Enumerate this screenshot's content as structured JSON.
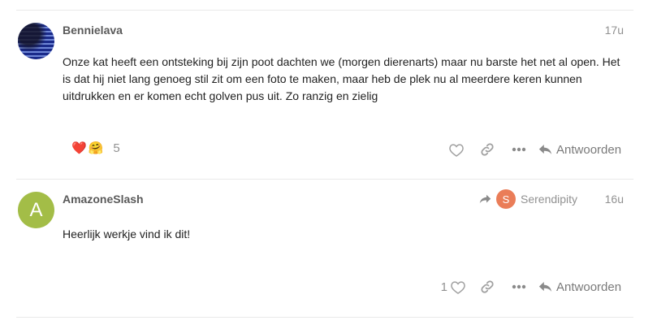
{
  "posts": [
    {
      "username": "Bennielava",
      "date": "17u",
      "avatar": "avatar-image-icon",
      "body": "Onze kat heeft een ontsteking bij zijn poot dachten we (morgen dierenarts) maar nu barste het net al open. Het is dat hij niet lang genoeg stil zit om een foto te maken, maar heb de plek nu al meerdere keren kunnen uitdrukken en er komen echt golven pus uit. Zo ranzig en zielig",
      "reactions": {
        "emojis": [
          "❤️",
          "🤗"
        ],
        "count": "5"
      },
      "actions": {
        "reply_label": "Antwoorden"
      }
    },
    {
      "username": "AmazoneSlash",
      "avatar_letter": "A",
      "avatar_color": "#a3bd47",
      "date": "16u",
      "reply_to": {
        "avatar_letter": "S",
        "avatar_color": "#ea7d58",
        "username": "Serendipity"
      },
      "body": "Heerlijk werkje vind ik dit!",
      "actions": {
        "like_count": "1",
        "reply_label": "Antwoorden"
      }
    }
  ]
}
